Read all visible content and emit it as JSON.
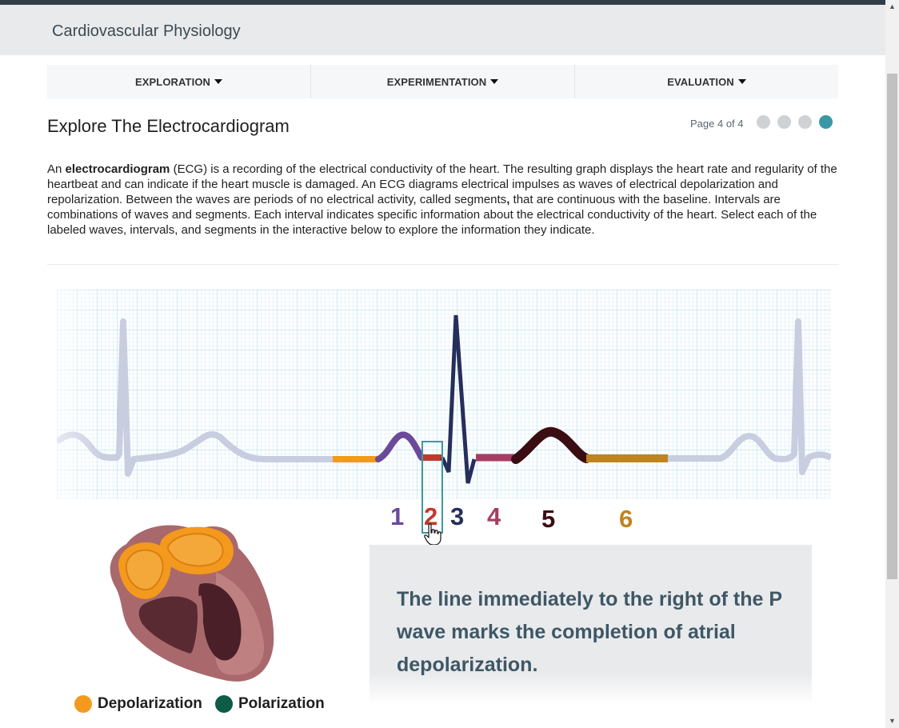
{
  "app": {
    "title": "Cardiovascular Physiology"
  },
  "nav": {
    "tabs": [
      {
        "label": "EXPLORATION"
      },
      {
        "label": "EXPERIMENTATION"
      },
      {
        "label": "EVALUATION"
      }
    ]
  },
  "page": {
    "title": "Explore The Electrocardiogram",
    "indicator": "Page 4 of 4",
    "dots_total": 4,
    "active_dot": 4
  },
  "intro": {
    "lead": "An ",
    "term1": "electrocardiogram",
    "part1": " (ECG) is a recording of the electrical conductivity of the heart. The resulting graph displays the heart rate and regularity of the heartbeat and can indicate if the heart muscle is damaged. An ECG diagrams electrical impulses as waves of electrical depolarization and repolarization. Between the waves are periods of no electrical activity, called segments",
    "term2": ",",
    "part2": " that are continuous with the baseline. Intervals are combinations of waves and segments. Each interval indicates specific information about the electrical conductivity of the heart. Select each of the labeled waves, intervals, and segments in the interactive below to explore the information they indicate."
  },
  "ecg": {
    "labels": [
      {
        "text": "1",
        "color": "#6b4a9a"
      },
      {
        "text": "2",
        "color": "#c0392b"
      },
      {
        "text": "3",
        "color": "#262e5c"
      },
      {
        "text": "4",
        "color": "#a63d62"
      },
      {
        "text": "5",
        "color": "#3a0d12"
      },
      {
        "text": "6",
        "color": "#c0841f"
      }
    ],
    "selected": "2",
    "colors": {
      "baseline": "#c8cde0",
      "grid_minor": "#c9e6f2",
      "grid_major": "#9fd0e6",
      "segment_orange": "#f39a1e",
      "p_wave": "#6b4a9a",
      "pr_segment": "#c0392b",
      "qrs": "#262e5c",
      "st_segment": "#a63d62",
      "t_wave": "#3a0d12",
      "tp_segment": "#c0841f"
    }
  },
  "heart": {
    "legend": [
      {
        "label": "Depolarization",
        "color": "#f39a1e"
      },
      {
        "label": "Polarization",
        "color": "#0d5c45"
      }
    ]
  },
  "info": {
    "text": "The line immediately to the right of the P wave marks the completion of atrial depolarization."
  }
}
